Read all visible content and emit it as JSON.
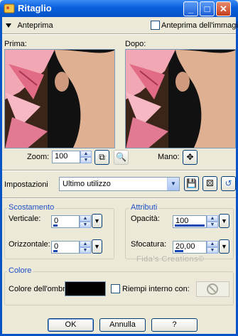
{
  "window": {
    "title": "Ritaglio",
    "buttons": {
      "minimize": "_",
      "maximize": "□",
      "close": "✕"
    }
  },
  "preview": {
    "toggle_label": "Anteprima",
    "on_image_label": "Anteprima dell'immagine",
    "on_image_checked": false,
    "before_label": "Prima:",
    "after_label": "Dopo:"
  },
  "zoom": {
    "label": "Zoom:",
    "value": "100",
    "pan_label": "Mano:"
  },
  "settings": {
    "label": "Impostazioni",
    "selected": "Ultimo utilizzo"
  },
  "offset": {
    "title": "Scostamento",
    "vertical_label": "Verticale:",
    "vertical_value": "0",
    "horizontal_label": "Orizzontale:",
    "horizontal_value": "0"
  },
  "attributes": {
    "title": "Attributi",
    "opacity_label": "Opacità:",
    "opacity_value": "100",
    "blur_label": "Sfocatura:",
    "blur_value": "20,00"
  },
  "color": {
    "title": "Colore",
    "shadow_label": "Colore dell'ombra:",
    "shadow_color": "#000000",
    "fill_label": "Riempi interno con:",
    "fill_checked": false
  },
  "watermark": "Fida's Creations©",
  "footer": {
    "ok": "OK",
    "cancel": "Annulla",
    "help": "?"
  }
}
